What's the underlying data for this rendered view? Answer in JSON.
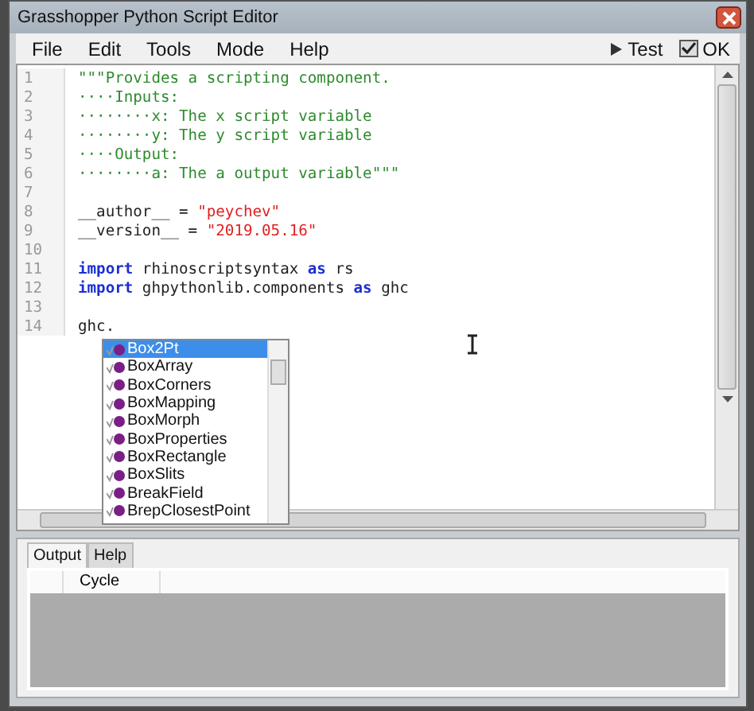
{
  "window": {
    "title": "Grasshopper Python Script Editor"
  },
  "menu": [
    "File",
    "Edit",
    "Tools",
    "Mode",
    "Help"
  ],
  "toolbar": [
    {
      "kind": "play",
      "label": "Test"
    },
    {
      "kind": "check",
      "label": "OK"
    }
  ],
  "code_lines": [
    {
      "number": "1",
      "tokens": [
        {
          "kind": "doc",
          "text": "\"\"\"Provides a scripting component."
        }
      ]
    },
    {
      "number": "2",
      "tokens": [
        {
          "kind": "doc",
          "text": "····Inputs:"
        }
      ]
    },
    {
      "number": "3",
      "tokens": [
        {
          "kind": "doc",
          "text": "········x: The x script variable"
        }
      ]
    },
    {
      "number": "4",
      "tokens": [
        {
          "kind": "doc",
          "text": "········y: The y script variable"
        }
      ]
    },
    {
      "number": "5",
      "tokens": [
        {
          "kind": "doc",
          "text": "····Output:"
        }
      ]
    },
    {
      "number": "6",
      "tokens": [
        {
          "kind": "doc",
          "text": "········a: The a output variable\"\"\""
        }
      ]
    },
    {
      "number": "7"
    },
    {
      "number": "8",
      "tokens": [
        {
          "kind": "plain",
          "text": "__author__ = "
        },
        {
          "kind": "string",
          "text": "\"peychev\""
        }
      ]
    },
    {
      "number": "9",
      "tokens": [
        {
          "kind": "plain",
          "text": "__version__ = "
        },
        {
          "kind": "string",
          "text": "\"2019.05.16\""
        }
      ]
    },
    {
      "number": "10"
    },
    {
      "number": "11",
      "tokens": [
        {
          "kind": "keyword",
          "text": "import"
        },
        {
          "kind": "plain",
          "text": " rhinoscriptsyntax "
        },
        {
          "kind": "keyword",
          "text": "as"
        },
        {
          "kind": "plain",
          "text": " rs"
        }
      ]
    },
    {
      "number": "12",
      "tokens": [
        {
          "kind": "keyword",
          "text": "import"
        },
        {
          "kind": "plain",
          "text": " ghpythonlib.components "
        },
        {
          "kind": "keyword",
          "text": "as"
        },
        {
          "kind": "plain",
          "text": " ghc"
        }
      ]
    },
    {
      "number": "13"
    },
    {
      "number": "14",
      "tokens": [
        {
          "kind": "plain",
          "text": "ghc."
        }
      ]
    }
  ],
  "completion": [
    {
      "label": "Box2Pt",
      "selected": true
    },
    {
      "label": "BoxArray",
      "selected": false
    },
    {
      "label": "BoxCorners",
      "selected": false
    },
    {
      "label": "BoxMapping",
      "selected": false
    },
    {
      "label": "BoxMorph",
      "selected": false
    },
    {
      "label": "BoxProperties",
      "selected": false
    },
    {
      "label": "BoxRectangle",
      "selected": false
    },
    {
      "label": "BoxSlits",
      "selected": false
    },
    {
      "label": "BreakField",
      "selected": false
    },
    {
      "label": "BrepClosestPoint",
      "selected": false
    }
  ],
  "panel_tabs": [
    {
      "label": "Output",
      "selected": true
    },
    {
      "label": "Help",
      "selected": false
    }
  ],
  "output_table": {
    "columns": [
      "Cycle"
    ]
  }
}
